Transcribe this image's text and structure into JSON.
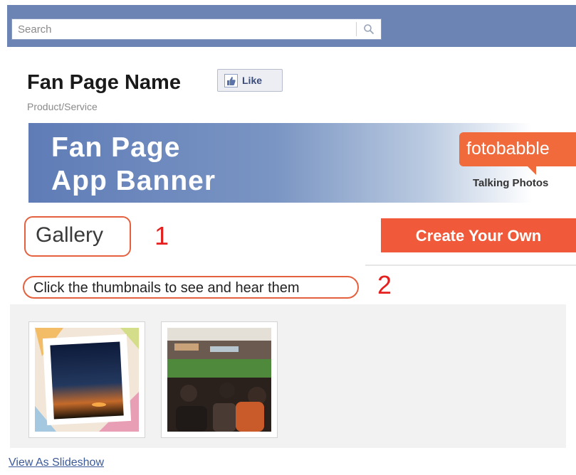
{
  "search": {
    "placeholder": "Search",
    "icon": "magnifier"
  },
  "page": {
    "title": "Fan Page Name",
    "category": "Product/Service"
  },
  "like_button": {
    "label": "Like",
    "icon": "thumbs-up"
  },
  "banner": {
    "line1": "Fan Page",
    "line2": "App Banner",
    "brand": "fotobabble",
    "tagline": "Talking Photos"
  },
  "gallery": {
    "label": "Gallery"
  },
  "annotations": {
    "first": "1",
    "second": "2"
  },
  "create_button": {
    "label": "Create Your Own"
  },
  "instructions": "Click the thumbnails to see and hear them",
  "thumbnails": [
    {
      "subject": "sunset photo in frame"
    },
    {
      "subject": "baseball stadium crowd"
    }
  ],
  "slideshow_link": "View As Slideshow",
  "colors": {
    "facebook_blue": "#6b84b4",
    "accent_orange": "#f05a3a",
    "annotation_red": "#e51e1e",
    "link_blue": "#3b5998"
  }
}
